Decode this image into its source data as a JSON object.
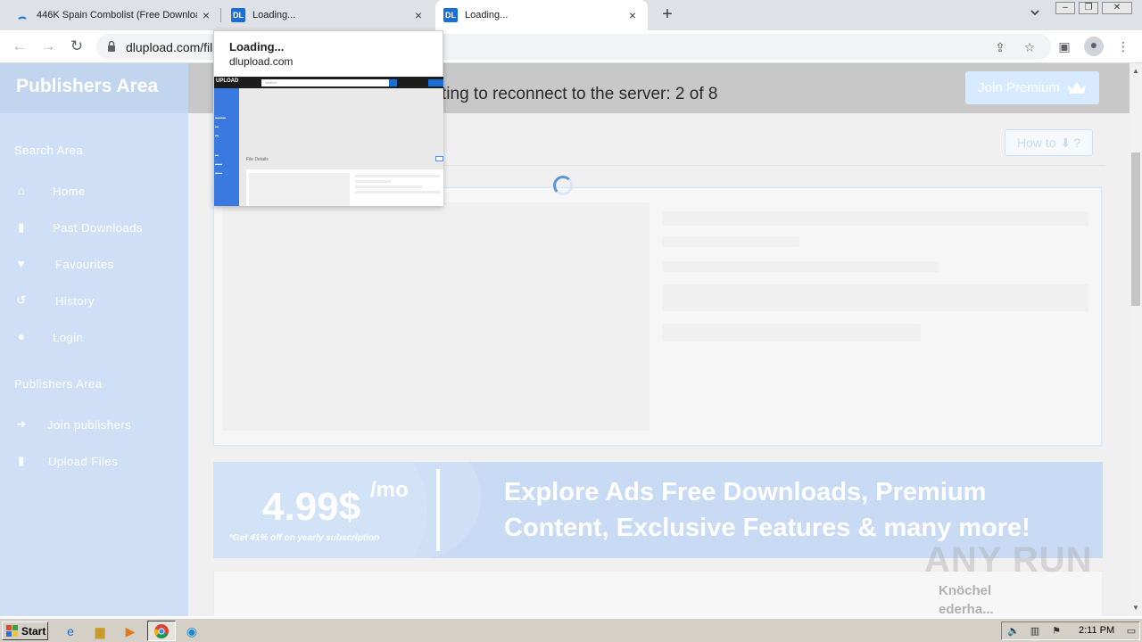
{
  "tabs": [
    {
      "title": "446K Spain Combolist (Free Downloa",
      "favicon": "loading-spinner-icon",
      "active": false
    },
    {
      "title": "Loading...",
      "favicon": "DL",
      "active": false
    },
    {
      "title": "Loading...",
      "favicon": "DL",
      "active": true
    }
  ],
  "browser": {
    "url": "dlupload.com/fil"
  },
  "hover_card": {
    "title": "Loading...",
    "domain": "dlupload.com",
    "thumb_logo": "UPLOAD",
    "thumb_search": "Search...",
    "thumb_label": "File Details"
  },
  "sidebar": {
    "brand": "Publishers Area",
    "section_search": "Search Area",
    "search_items": [
      {
        "label": "Home",
        "icon": "home-icon"
      },
      {
        "label": "Past Downloads",
        "icon": "file-icon"
      },
      {
        "label": "Favourites",
        "icon": "heart-icon"
      },
      {
        "label": "History",
        "icon": "history-icon"
      },
      {
        "label": "Login",
        "icon": "user-icon"
      }
    ],
    "section_publishers": "Publishers Area",
    "publisher_items": [
      {
        "label": "Join publishers",
        "icon": "sign-in-icon"
      },
      {
        "label": "Upload Files",
        "icon": "file-upload-icon"
      }
    ]
  },
  "header": {
    "reconnect_text": "ting to reconnect to the server: 2 of 8",
    "premium_label": "Join Premium"
  },
  "content": {
    "howto_label": "How to",
    "howto_suffix": "?"
  },
  "banner": {
    "price": "4.99$",
    "per": "/mo",
    "yearly": "*Get 41% off on yearly subscription",
    "line1": "Explore Ads Free Downloads, Premium",
    "line2": "Content, Exclusive Features & many more!"
  },
  "watermark": {
    "brand": "ANY RUN",
    "sub_line1": "Knöchel",
    "sub_line2": "ederha..."
  },
  "taskbar": {
    "start_label": "Start",
    "clock": "2:11 PM"
  },
  "colors": {
    "brand_blue": "#1a6fd6",
    "sidebar_bg": "#cfe0f6",
    "banner_bg": "#c9daf4"
  }
}
